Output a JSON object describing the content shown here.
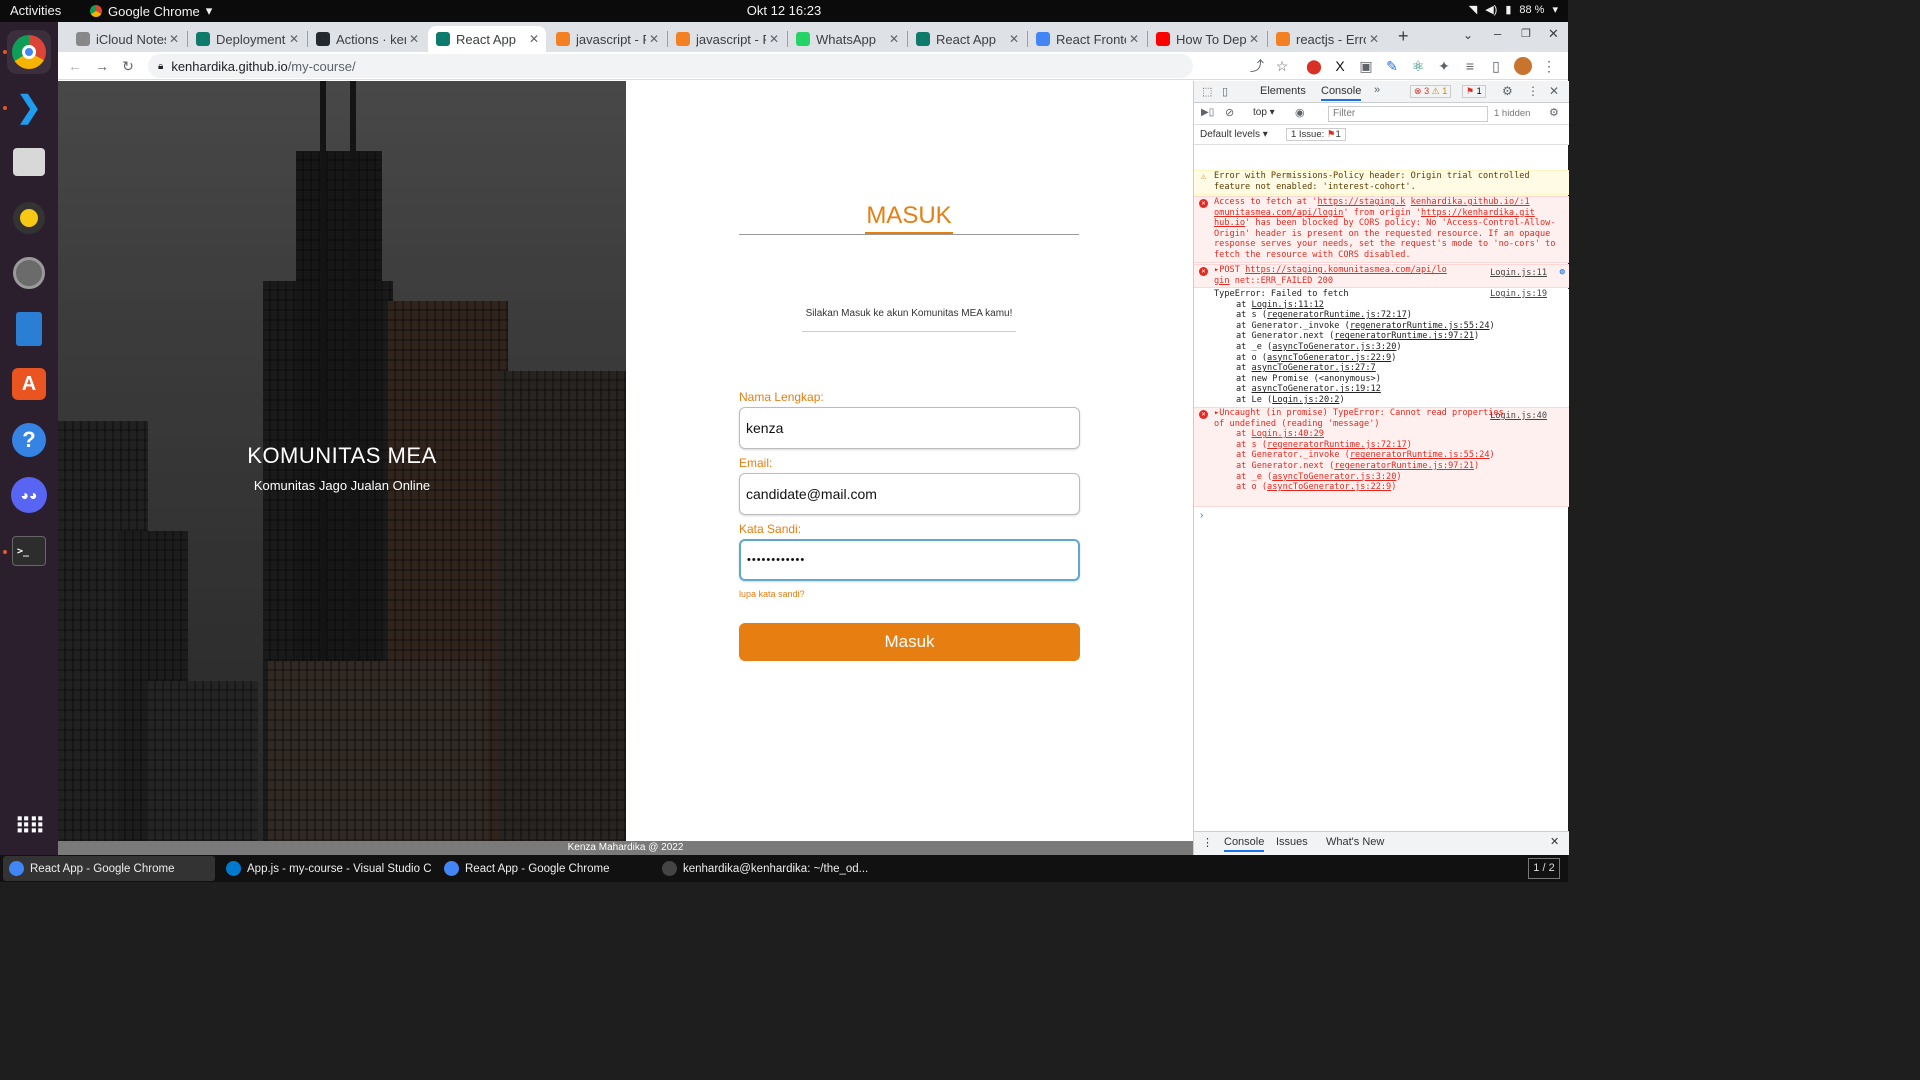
{
  "topbar": {
    "activities": "Activities",
    "app_menu": "Google Chrome",
    "clock": "Okt 12  16:23",
    "battery": "88 %"
  },
  "tabs": [
    {
      "label": "iCloud Notes",
      "color": "#888888"
    },
    {
      "label": "Deployments",
      "color": "#0e7a6b"
    },
    {
      "label": "Actions · kenhardika",
      "color": "#24292f"
    },
    {
      "label": "React App",
      "color": "#0e7a6b"
    },
    {
      "label": "javascript - Fetch",
      "color": "#f48024"
    },
    {
      "label": "javascript - Fetch",
      "color": "#f48024"
    },
    {
      "label": "WhatsApp",
      "color": "#25d366"
    },
    {
      "label": "React App",
      "color": "#0e7a6b"
    },
    {
      "label": "React Frontend",
      "color": "#4285f4"
    },
    {
      "label": "How To Deploy",
      "color": "#ff0000"
    },
    {
      "label": "reactjs - Error",
      "color": "#f48024"
    }
  ],
  "omnibox": {
    "host": "kenhardika.github.io",
    "path": "/my-course/"
  },
  "page": {
    "hero_title": "KOMUNITAS MEA",
    "hero_subtitle": "Komunitas Jago Jualan Online",
    "form_title": "MASUK",
    "intro": "Silakan Masuk ke akun Komunitas MEA kamu!",
    "name_label": "Nama Lengkap:",
    "name_value": "kenza",
    "email_label": "Email:",
    "email_value": "candidate@mail.com",
    "password_label": "Kata Sandi:",
    "password_value": "••••••••••••",
    "forgot": "lupa kata sandi?",
    "submit": "Masuk",
    "footer": "Kenza Mahardika @ 2022"
  },
  "devtools": {
    "tab_elements": "Elements",
    "tab_console": "Console",
    "counts": {
      "errors": "3",
      "warnings": "1",
      "issues": "1"
    },
    "context": "top",
    "filter_placeholder": "Filter",
    "hidden": "1 hidden",
    "levels": "Default levels",
    "issue_badge": "1 Issue:",
    "issue_count": "1",
    "messages": {
      "warn": "Error with Permissions-Policy header: Origin trial controlled feature not enabled: 'interest-cohort'.",
      "cors_1": "Access to fetch at '",
      "cors_url": "https://staging.k",
      "cors_src": "kenhardika.github.io/:1",
      "cors_2": "omunitasmea.com/api/login",
      "cors_3": "' from origin '",
      "cors_origin": "https://kenhardika.git",
      "cors_4": "hub.io",
      "cors_5": "' has been blocked by CORS policy: No 'Access-Control-Allow-Origin' header is present on the requested resource. If an opaque response serves your needs, set the request's mode to 'no-cors' to fetch the resource with CORS disabled.",
      "post_1": "POST ",
      "post_url": "https://staging.komunitasmea.com/api/lo",
      "post_url2": "gin",
      "post_2": " net::ERR_FAILED 200",
      "post_src": "Login.js:11",
      "typeerr": "TypeError: Failed to fetch",
      "typeerr_src": "Login.js:19",
      "stack1": [
        {
          "pre": "at ",
          "link": "Login.js:11:12",
          "post": ""
        },
        {
          "pre": "at s (",
          "link": "regeneratorRuntime.js:72:17",
          "post": ")"
        },
        {
          "pre": "at Generator._invoke (",
          "link": "regeneratorRuntime.js:55:24",
          "post": ")"
        },
        {
          "pre": "at Generator.next (",
          "link": "regeneratorRuntime.js:97:21",
          "post": ")"
        },
        {
          "pre": "at _e (",
          "link": "asyncToGenerator.js:3:20",
          "post": ")"
        },
        {
          "pre": "at o (",
          "link": "asyncToGenerator.js:22:9",
          "post": ")"
        },
        {
          "pre": "at ",
          "link": "asyncToGenerator.js:27:7",
          "post": ""
        },
        {
          "pre": "at new Promise (<anonymous>)",
          "link": "",
          "post": ""
        },
        {
          "pre": "at ",
          "link": "asyncToGenerator.js:19:12",
          "post": ""
        },
        {
          "pre": "at Le (",
          "link": "Login.js:20:2",
          "post": ")"
        }
      ],
      "uncaught": "Uncaught (in promise) TypeError: Cannot read properties of undefined (reading 'message')",
      "uncaught_src": "Login.js:40",
      "stack2": [
        {
          "pre": "at ",
          "link": "Login.js:40:29",
          "post": ""
        },
        {
          "pre": "at s (",
          "link": "regeneratorRuntime.js:72:17",
          "post": ")"
        },
        {
          "pre": "at Generator._invoke (",
          "link": "regeneratorRuntime.js:55:24",
          "post": ")"
        },
        {
          "pre": "at Generator.next (",
          "link": "regeneratorRuntime.js:97:21",
          "post": ")"
        },
        {
          "pre": "at _e (",
          "link": "asyncToGenerator.js:3:20",
          "post": ")"
        },
        {
          "pre": "at o (",
          "link": "asyncToGenerator.js:22:9",
          "post": ")"
        }
      ]
    },
    "bottom_console": "Console",
    "bottom_issues": "Issues",
    "bottom_whatsnew": "What's New"
  },
  "taskbar": [
    {
      "label": "React App - Google Chrome",
      "color": "#4285f4"
    },
    {
      "label": "App.js - my-course - Visual Studio C...",
      "color": "#007acc"
    },
    {
      "label": "React App - Google Chrome",
      "color": "#4285f4"
    },
    {
      "label": "kenhardika@kenhardika: ~/the_od...",
      "color": "#444444"
    }
  ],
  "workspace": "1 / 2",
  "colors": {
    "accent": "#e67e11",
    "focus": "#5fa8d3",
    "error": "#e42a20"
  }
}
